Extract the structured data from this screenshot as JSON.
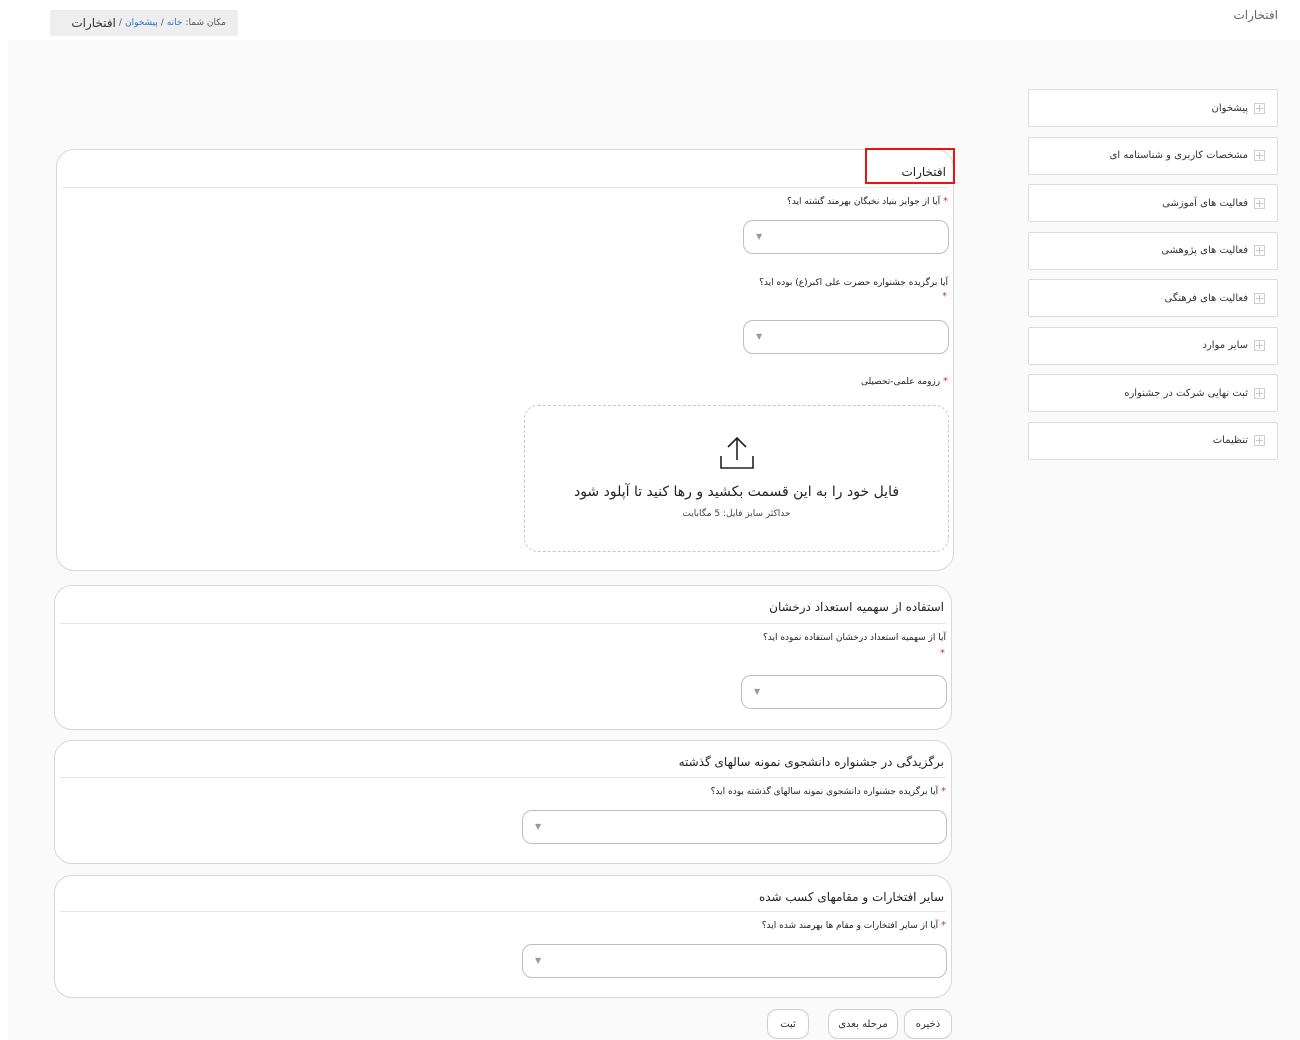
{
  "page": {
    "title": "افتخارات"
  },
  "breadcrumb": {
    "prefix": "مکان شما:",
    "home": "خانه",
    "sep1": "/",
    "dashboard": "پیشخوان",
    "sep2": "/",
    "current": "افتخارات"
  },
  "sidebar": {
    "items": [
      {
        "label": "پیشخوان"
      },
      {
        "label": "مشخصات کاربری و شناسنامه ای"
      },
      {
        "label": "فعالیت های آموزشی"
      },
      {
        "label": "فعالیت های پژوهشی"
      },
      {
        "label": "فعالیت های فرهنگی"
      },
      {
        "label": "سایر موارد"
      },
      {
        "label": "ثبت نهایی شرکت در جشنواره"
      },
      {
        "label": "تنظیمات"
      }
    ]
  },
  "panels": {
    "honors": {
      "title": "افتخارات",
      "q1": "آیا از جوایز بنیاد نخبگان بهرمند گشته اید؟",
      "q2": "آیا برگزیده جشنواره حضرت علی اکبر(ع) بوده اید؟",
      "q3": "رزومه علمی-تحصیلی",
      "upload_text": "فایل خود را به این قسمت بکشید و رها کنید تا آپلود شود",
      "upload_limit": "حداکثر سایز فایل: 5 مگابایت"
    },
    "talent": {
      "title": "استفاده از سهمیه استعداد درخشان",
      "q1": "آیا از سهمیه استعداد درخشان استفاده نموده اید؟"
    },
    "exemplary": {
      "title": "برگزیدگی در جشنواره دانشجوی نمونه سالهای گذشته",
      "q1": "آیا برگزیده جشنواره دانشجوی نمونه سالهای گذشته بوده اید؟"
    },
    "other": {
      "title": "سایر افتخارات و مقامهای کسب شده",
      "q1": "آیا از سایر افتخارات و مقام ها بهرمند شده اید؟"
    }
  },
  "required_mark": "*",
  "caret": "▼",
  "buttons": {
    "save": "ذخیره",
    "next": "مرحله بعدی",
    "submit": "ثبت"
  }
}
